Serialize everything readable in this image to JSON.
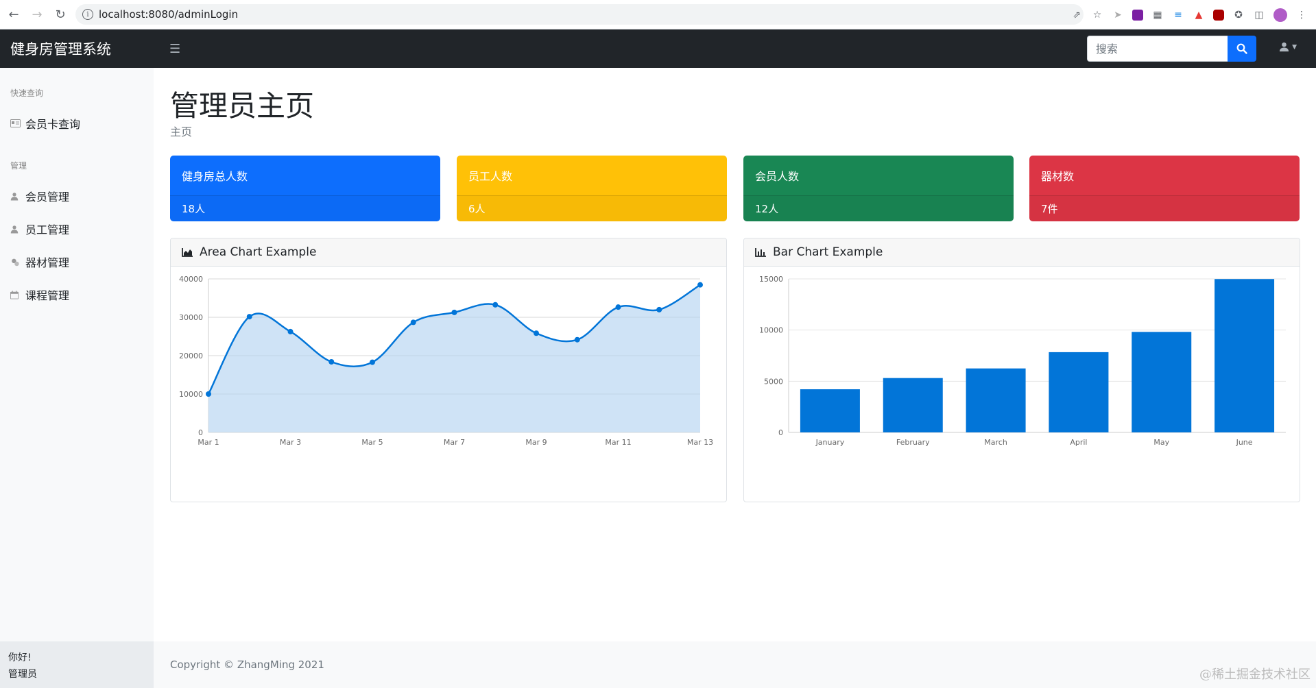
{
  "browser": {
    "url": "localhost:8080/adminLogin"
  },
  "navbar": {
    "brand": "健身房管理系统",
    "search_placeholder": "搜索"
  },
  "sidebar": {
    "section_quick": "快速查询",
    "quick_items": [
      {
        "label": "会员卡查询",
        "icon": "id-card-icon"
      }
    ],
    "section_manage": "管理",
    "manage_items": [
      {
        "label": "会员管理",
        "icon": "user-icon"
      },
      {
        "label": "员工管理",
        "icon": "user-icon"
      },
      {
        "label": "器材管理",
        "icon": "equipment-icon"
      },
      {
        "label": "课程管理",
        "icon": "calendar-icon"
      }
    ],
    "footer_line1": "你好!",
    "footer_line2": "管理员"
  },
  "main": {
    "title": "管理员主页",
    "breadcrumb": "主页",
    "cards": [
      {
        "title": "健身房总人数",
        "value": "18人",
        "color": "#0d6efd"
      },
      {
        "title": "员工人数",
        "value": "6人",
        "color": "#ffc107"
      },
      {
        "title": "会员人数",
        "value": "12人",
        "color": "#198754"
      },
      {
        "title": "器材数",
        "value": "7件",
        "color": "#dc3545"
      }
    ],
    "area_chart_title": "Area Chart Example",
    "bar_chart_title": "Bar Chart Example"
  },
  "footer": {
    "copyright": "Copyright © ZhangMing 2021",
    "watermark": "@稀土掘金技术社区"
  },
  "chart_data": [
    {
      "type": "area",
      "title": "Area Chart Example",
      "x": [
        "Mar 1",
        "Mar 2",
        "Mar 3",
        "Mar 4",
        "Mar 5",
        "Mar 6",
        "Mar 7",
        "Mar 8",
        "Mar 9",
        "Mar 10",
        "Mar 11",
        "Mar 12",
        "Mar 13"
      ],
      "x_tick_labels": [
        "Mar 1",
        "Mar 3",
        "Mar 5",
        "Mar 7",
        "Mar 9",
        "Mar 11",
        "Mar 13"
      ],
      "values": [
        10000,
        30162,
        26263,
        18394,
        18287,
        28682,
        31274,
        33259,
        25849,
        24159,
        32651,
        31984,
        38451
      ],
      "ylim": [
        0,
        40000
      ],
      "y_ticks": [
        0,
        10000,
        20000,
        30000,
        40000
      ],
      "line_color": "#0275d8",
      "fill_color": "#cce1f5",
      "grid": true,
      "legend": "none"
    },
    {
      "type": "bar",
      "title": "Bar Chart Example",
      "categories": [
        "January",
        "February",
        "March",
        "April",
        "May",
        "June"
      ],
      "values": [
        4215,
        5312,
        6251,
        7841,
        9821,
        14984
      ],
      "ylim": [
        0,
        15000
      ],
      "y_ticks": [
        0,
        5000,
        10000,
        15000
      ],
      "bar_color": "#0275d8",
      "grid": true,
      "legend": "none"
    }
  ]
}
